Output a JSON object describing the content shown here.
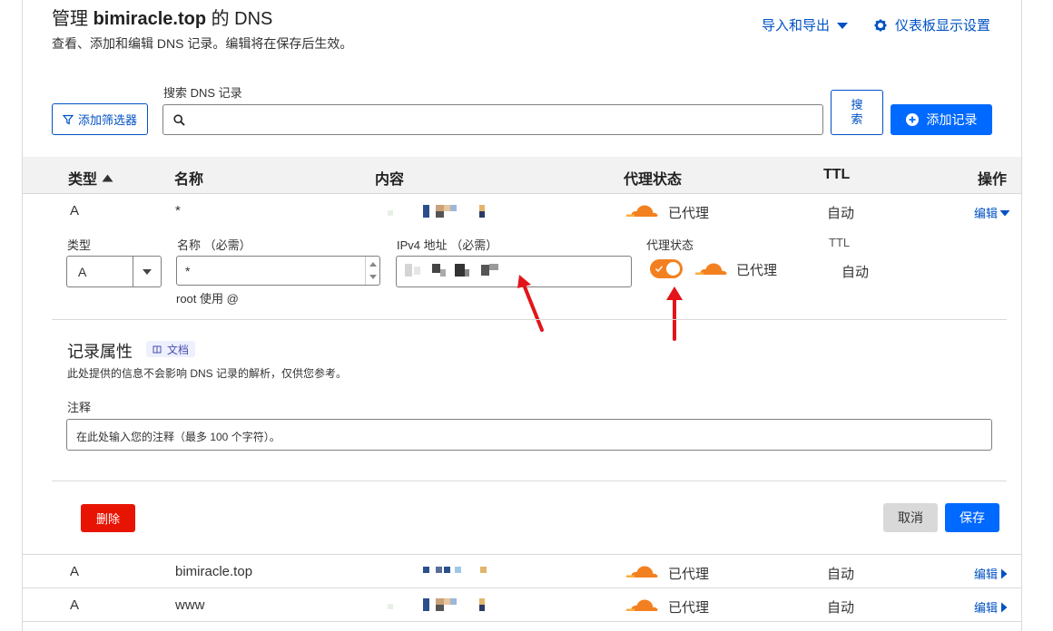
{
  "header": {
    "title_prefix": "管理 ",
    "domain": "bimiracle.top",
    "title_suffix": " 的 DNS",
    "description": "查看、添加和编辑 DNS 记录。编辑将在保存后生效。",
    "import_export": "导入和导出",
    "dashboard_settings": "仪表板显示设置"
  },
  "search": {
    "label": "搜索 DNS 记录",
    "filter_button": "添加筛选器",
    "search_button": "搜索",
    "add_record_button": "添加记录"
  },
  "table": {
    "columns": {
      "type": "类型",
      "name": "名称",
      "content": "内容",
      "proxy": "代理状态",
      "ttl": "TTL",
      "actions": "操作"
    },
    "rows": [
      {
        "type": "A",
        "name": "*",
        "proxy": "已代理",
        "ttl": "自动",
        "edit": "编辑"
      },
      {
        "type": "A",
        "name": "bimiracle.top",
        "proxy": "已代理",
        "ttl": "自动",
        "edit": "编辑"
      },
      {
        "type": "A",
        "name": "www",
        "proxy": "已代理",
        "ttl": "自动",
        "edit": "编辑"
      }
    ]
  },
  "edit_form": {
    "type_label": "类型",
    "type_value": "A",
    "name_label": "名称 （必需）",
    "name_value": "*",
    "name_hint": "root 使用 @",
    "ipv4_label": "IPv4 地址 （必需）",
    "proxy_label": "代理状态",
    "proxy_value": "已代理",
    "proxy_enabled": true,
    "ttl_label": "TTL",
    "ttl_value": "自动",
    "record_attributes_title": "记录属性",
    "docs_badge": "文档",
    "attributes_desc": "此处提供的信息不会影响 DNS 记录的解析，仅供您参考。",
    "comment_label": "注释",
    "comment_placeholder": "在此处输入您的注释（最多 100 个字符）。",
    "delete_button": "删除",
    "cancel_button": "取消",
    "save_button": "保存"
  },
  "colors": {
    "accent": "#0051c3",
    "primary": "#0069ff",
    "danger": "#e81403",
    "toggle": "#f38020",
    "arrow": "#e3141b"
  }
}
